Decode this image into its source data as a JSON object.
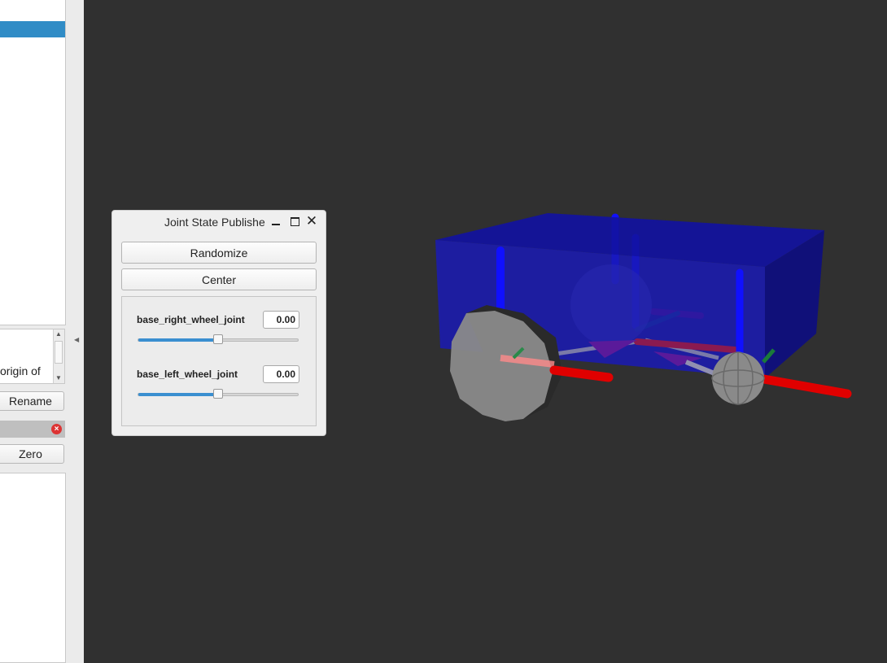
{
  "left_panel": {
    "description_text": "origin of",
    "rename_label": "Rename",
    "zero_label": "Zero"
  },
  "jsp_window": {
    "title": "Joint State Publisher",
    "randomize_label": "Randomize",
    "center_label": "Center",
    "joints": [
      {
        "name": "base_right_wheel_joint",
        "value": "0.00",
        "slider_fraction": 0.5
      },
      {
        "name": "base_left_wheel_joint",
        "value": "0.00",
        "slider_fraction": 0.5
      }
    ]
  },
  "colors": {
    "selection": "#308cc6",
    "viewport_bg": "#303030",
    "slider_fill": "#3a8fd0",
    "chassis": "#1a1aa0",
    "axis_x": "#e00000",
    "axis_z": "#1010ff",
    "axis_y": "#1a7a3a"
  }
}
